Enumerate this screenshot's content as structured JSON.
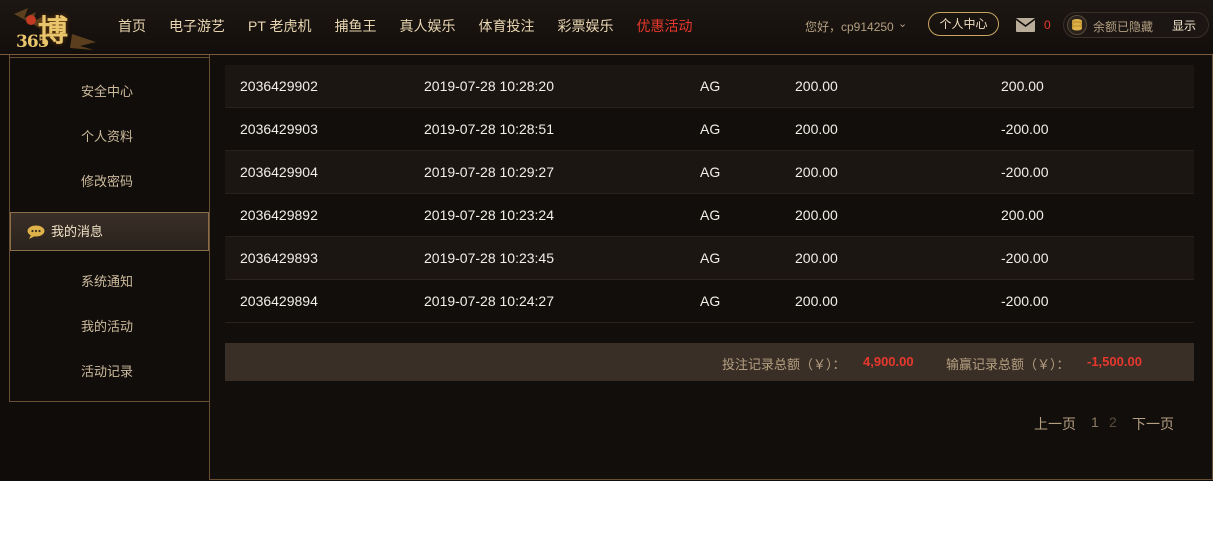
{
  "header": {
    "logo": {
      "glyph": "博",
      "number": "365"
    },
    "nav": [
      {
        "label": "首页",
        "active": false
      },
      {
        "label": "电子游艺",
        "active": false
      },
      {
        "label": "PT 老虎机",
        "active": false
      },
      {
        "label": "捕鱼王",
        "active": false
      },
      {
        "label": "真人娱乐",
        "active": false
      },
      {
        "label": "体育投注",
        "active": false
      },
      {
        "label": "彩票娱乐",
        "active": false
      },
      {
        "label": "优惠活动",
        "active": true
      }
    ],
    "greeting": "您好，cp914250",
    "user_center_label": "个人中心",
    "mail_count": "0",
    "balance_hidden_text": "余额已隐藏",
    "show_label": "显示"
  },
  "sidebar": {
    "group1": [
      {
        "label": "安全中心"
      },
      {
        "label": "个人资料"
      },
      {
        "label": "修改密码"
      }
    ],
    "messages_header": "我的消息",
    "group2": [
      {
        "label": "系统通知"
      },
      {
        "label": "我的活动"
      },
      {
        "label": "活动记录"
      }
    ]
  },
  "table": {
    "rows": [
      {
        "id": "2036429902",
        "time": "2019-07-28 10:28:20",
        "platform": "AG",
        "bet": "200.00",
        "result": "200.00"
      },
      {
        "id": "2036429903",
        "time": "2019-07-28 10:28:51",
        "platform": "AG",
        "bet": "200.00",
        "result": "-200.00"
      },
      {
        "id": "2036429904",
        "time": "2019-07-28 10:29:27",
        "platform": "AG",
        "bet": "200.00",
        "result": "-200.00"
      },
      {
        "id": "2036429892",
        "time": "2019-07-28 10:23:24",
        "platform": "AG",
        "bet": "200.00",
        "result": "200.00"
      },
      {
        "id": "2036429893",
        "time": "2019-07-28 10:23:45",
        "platform": "AG",
        "bet": "200.00",
        "result": "-200.00"
      },
      {
        "id": "2036429894",
        "time": "2019-07-28 10:24:27",
        "platform": "AG",
        "bet": "200.00",
        "result": "-200.00"
      }
    ]
  },
  "summary": {
    "bet_total_label": "投注记录总额（￥）：",
    "bet_total_value": "4,900.00",
    "win_total_label": "输赢记录总额（￥）：",
    "win_total_value": "-1,500.00"
  },
  "pagination": {
    "prev_label": "上一页",
    "page1": "1",
    "page2": "2",
    "next_label": "下一页"
  },
  "colors": {
    "accent_red": "#e8382d",
    "gold": "#c8a562",
    "background": "#0f0c0a"
  }
}
